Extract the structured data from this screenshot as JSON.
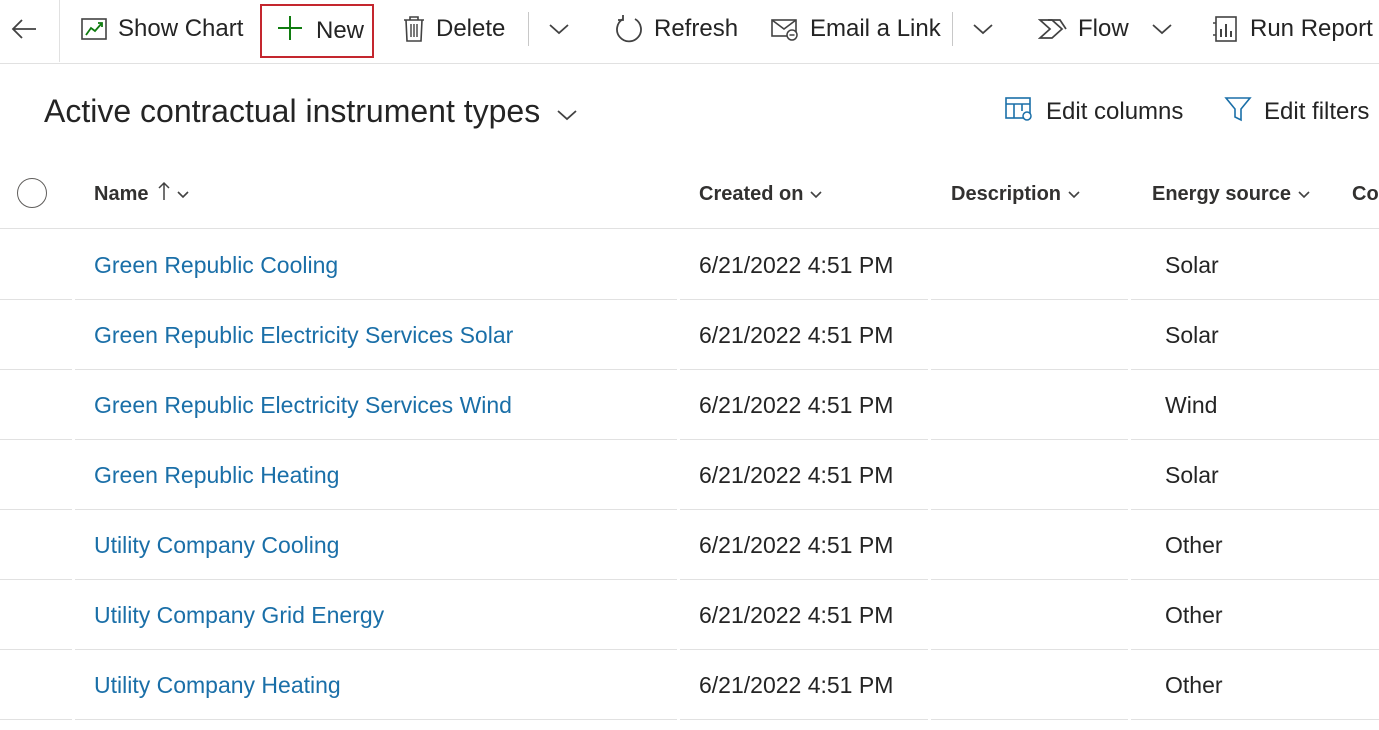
{
  "toolbar": {
    "back_label": "",
    "show_chart": "Show Chart",
    "new": "New",
    "delete": "Delete",
    "refresh": "Refresh",
    "email_link": "Email a Link",
    "flow": "Flow",
    "run_report": "Run Report"
  },
  "view": {
    "title": "Active contractual instrument types",
    "edit_columns": "Edit columns",
    "edit_filters": "Edit filters"
  },
  "grid": {
    "columns": {
      "name": "Name",
      "created_on": "Created on",
      "description": "Description",
      "energy_source": "Energy source",
      "next": "Co"
    },
    "rows": [
      {
        "name": "Green Republic Cooling",
        "created_on": "6/21/2022 4:51 PM",
        "description": "",
        "energy_source": "Solar"
      },
      {
        "name": "Green Republic Electricity Services Solar",
        "created_on": "6/21/2022 4:51 PM",
        "description": "",
        "energy_source": "Solar"
      },
      {
        "name": "Green Republic Electricity Services Wind",
        "created_on": "6/21/2022 4:51 PM",
        "description": "",
        "energy_source": "Wind"
      },
      {
        "name": "Green Republic Heating",
        "created_on": "6/21/2022 4:51 PM",
        "description": "",
        "energy_source": "Solar"
      },
      {
        "name": "Utility Company Cooling",
        "created_on": "6/21/2022 4:51 PM",
        "description": "",
        "energy_source": "Other"
      },
      {
        "name": "Utility Company Grid Energy",
        "created_on": "6/21/2022 4:51 PM",
        "description": "",
        "energy_source": "Other"
      },
      {
        "name": "Utility Company Heating",
        "created_on": "6/21/2022 4:51 PM",
        "description": "",
        "energy_source": "Other"
      }
    ]
  },
  "colors": {
    "link": "#1a6fa8",
    "highlight_border": "#c4262e",
    "new_icon": "#107c10",
    "divider": "#e1e1e1"
  },
  "icons": {
    "back": "arrow-left-icon",
    "show_chart": "chart-icon",
    "new": "plus-icon",
    "delete": "trash-icon",
    "refresh": "refresh-icon",
    "email_link": "email-link-icon",
    "flow": "flow-icon",
    "run_report": "report-icon",
    "edit_columns": "columns-icon",
    "edit_filters": "filter-icon"
  }
}
